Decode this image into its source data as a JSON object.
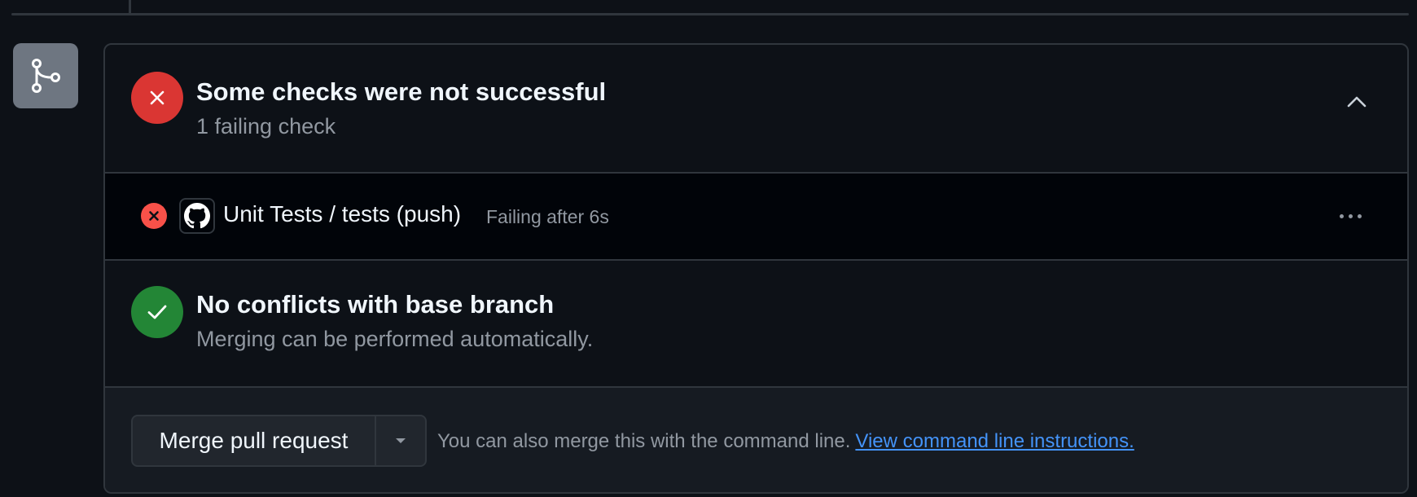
{
  "checks": {
    "title": "Some checks were not successful",
    "subtitle": "1 failing check",
    "status_color": "#da3633",
    "collapse_icon": "chevron-up-icon"
  },
  "check_row": {
    "name": "Unit Tests / tests (push)",
    "status": "Failing after 6s",
    "status_icon": "x-circle-icon",
    "app_icon": "github-icon",
    "menu_icon": "kebab-horizontal-icon"
  },
  "conflicts": {
    "title": "No conflicts with base branch",
    "subtitle": "Merging can be performed automatically.",
    "status_color": "#238636"
  },
  "merge": {
    "button_label": "Merge pull request",
    "dropdown_icon": "triangle-down-icon",
    "note": "You can also merge this with the command line.",
    "link_label": "View command line instructions."
  },
  "sidebar": {
    "icon": "git-merge-icon"
  },
  "colors": {
    "background": "#0d1117",
    "border": "#30363d",
    "link": "#4493f8",
    "muted_text": "#9198a1"
  }
}
